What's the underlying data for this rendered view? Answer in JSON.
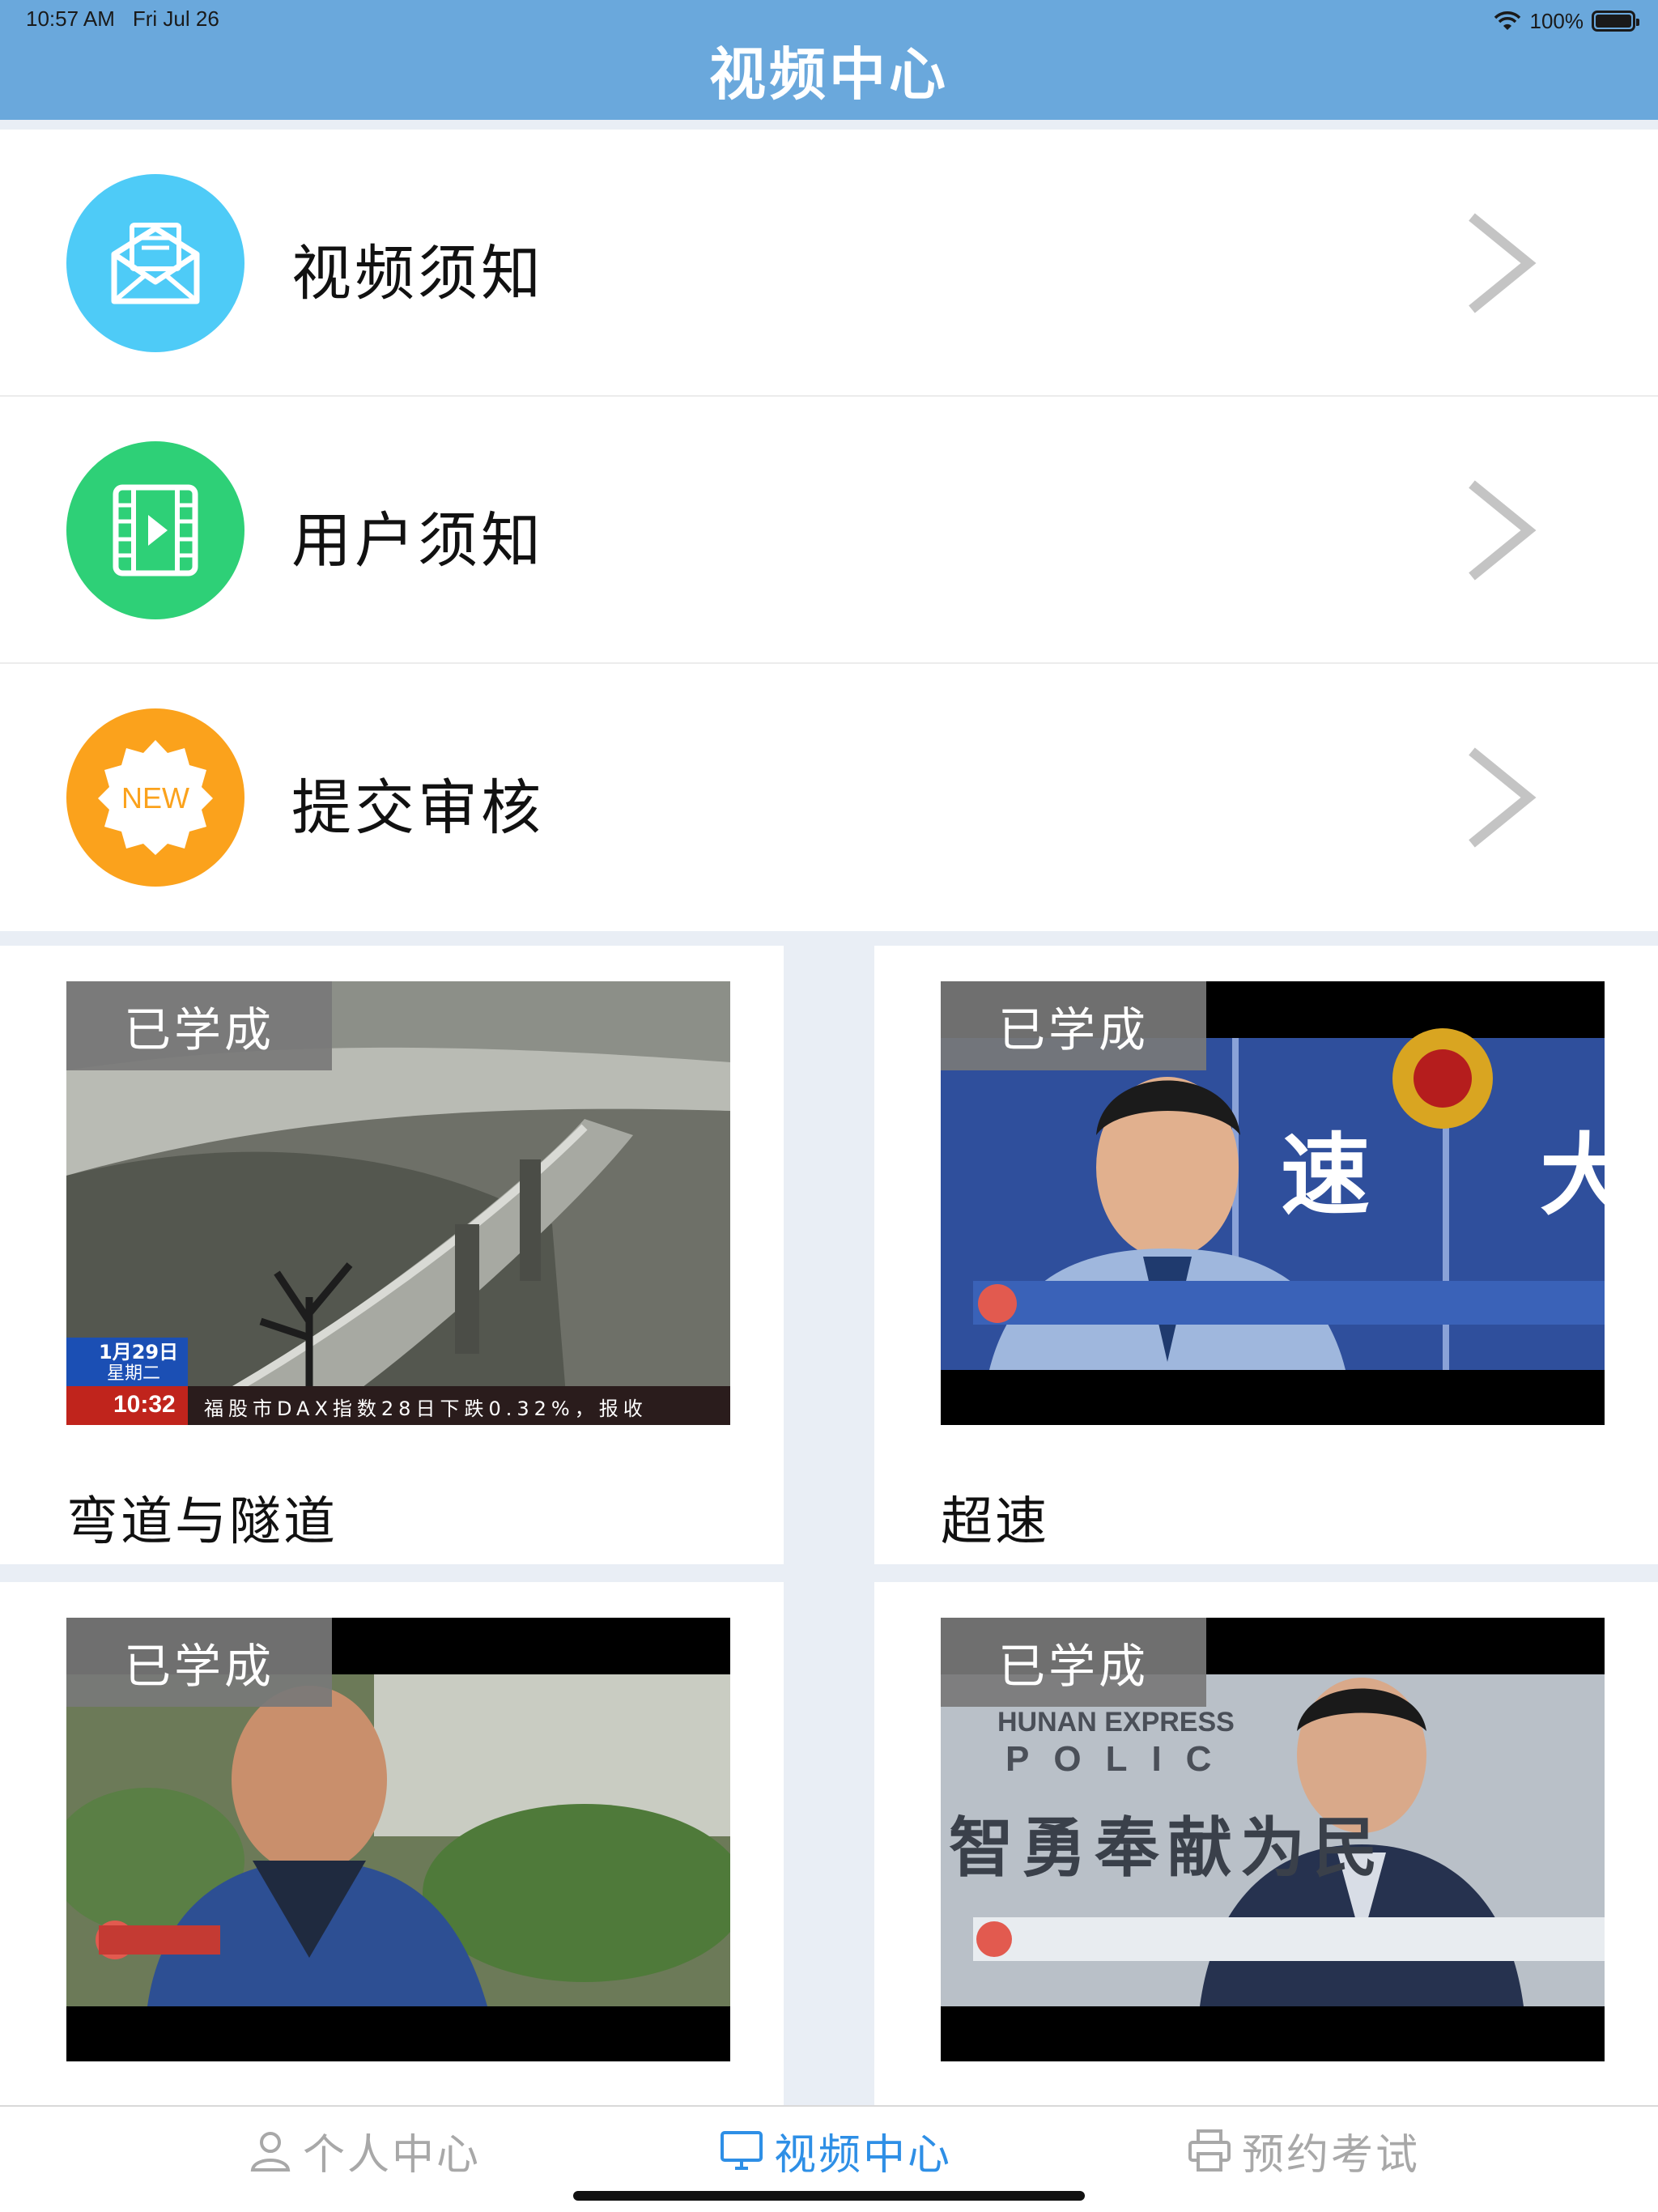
{
  "status_bar": {
    "time": "10:57 AM",
    "date": "Fri Jul 26",
    "battery": "100%",
    "battery_level": 1.0
  },
  "nav": {
    "title": "视频中心"
  },
  "menu": [
    {
      "label": "视频须知",
      "icon": "envelope-icon",
      "color": "#4ecbf7"
    },
    {
      "label": "用户须知",
      "icon": "film-play-icon",
      "color": "#2ed077"
    },
    {
      "label": "提交审核",
      "icon": "new-badge-icon",
      "color": "#fba21c",
      "icon_text": "NEW"
    }
  ],
  "videos": [
    {
      "title": "弯道与隧道",
      "badge": "已学成",
      "thumb": "highway-curve-footage",
      "overlay": {
        "date": "1月29日",
        "weekday": "星期二",
        "time": "10:32",
        "ticker": "福股市DAX指数28日下跌0.32%，报收"
      }
    },
    {
      "title": "超速",
      "badge": "已学成",
      "thumb": "police-officer-interview",
      "overlay": {
        "wall_text": [
          "速",
          "大"
        ]
      }
    },
    {
      "title": "",
      "badge": "已学成",
      "thumb": "driver-interview"
    },
    {
      "title": "",
      "badge": "已学成",
      "thumb": "highway-police-interview",
      "overlay": {
        "wall_en_1": "HUNAN EXPRESS",
        "wall_en_2": "POLIC",
        "wall_cn": "智勇奉献为民"
      }
    }
  ],
  "tabbar": [
    {
      "label": "个人中心",
      "icon": "person-icon",
      "active": false
    },
    {
      "label": "视频中心",
      "icon": "monitor-icon",
      "active": true
    },
    {
      "label": "预约考试",
      "icon": "printer-icon",
      "active": false
    }
  ],
  "colors": {
    "nav": "#6aa8dc",
    "tab_active": "#2e8fe6",
    "tab_inactive": "#a8a8a8"
  }
}
